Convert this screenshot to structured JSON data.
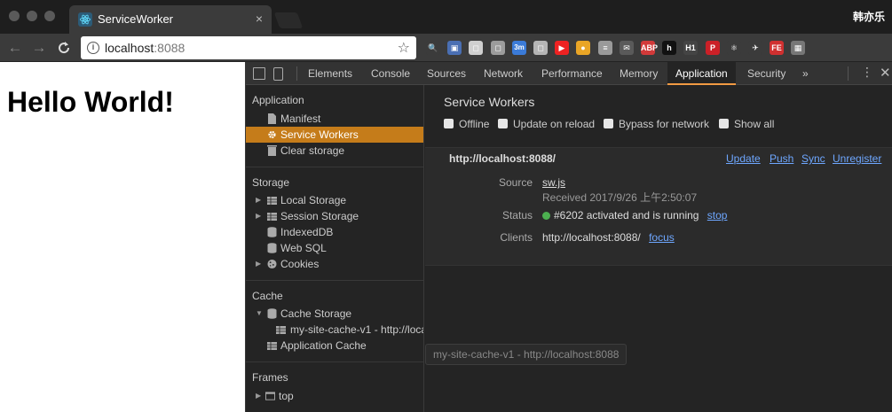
{
  "browser": {
    "tab_title": "ServiceWorker",
    "tab_close": "×",
    "username": "韩亦乐",
    "url_host": "localhost",
    "url_port": ":8088",
    "star": "☆",
    "back": "←",
    "forward": "→",
    "reload": "C",
    "extensions": [
      {
        "icon": "magnifier-icon",
        "label": "🔍",
        "color": "#3b3b3b"
      },
      {
        "icon": "picture-icon",
        "label": "▣",
        "color": "#4a6fb3"
      },
      {
        "icon": "box-icon",
        "label": "◻",
        "color": "#cfcfcf"
      },
      {
        "icon": "tile-icon",
        "label": "◻",
        "color": "#9c9c9c"
      },
      {
        "icon": "calendar-icon",
        "label": "3m",
        "color": "#3b7bd8"
      },
      {
        "icon": "page-icon",
        "label": "◻",
        "color": "#b5b5b5"
      },
      {
        "icon": "youtube-icon",
        "label": "▶",
        "color": "#e22"
      },
      {
        "icon": "chrome-icon",
        "label": "●",
        "color": "#e9a526"
      },
      {
        "icon": "note-icon",
        "label": "≡",
        "color": "#9a9a9a"
      },
      {
        "icon": "mail-icon",
        "label": "✉",
        "color": "#5a5a5a"
      },
      {
        "icon": "abp-icon",
        "label": "ABP",
        "color": "#d23a3a"
      },
      {
        "icon": "h-icon",
        "label": "h",
        "color": "#111"
      },
      {
        "icon": "h1-icon",
        "label": "H1",
        "color": "#444"
      },
      {
        "icon": "pinterest-icon",
        "label": "P",
        "color": "#cb2027"
      },
      {
        "icon": "react-icon",
        "label": "⚛",
        "color": "#3b3b3b"
      },
      {
        "icon": "bird-icon",
        "label": "✈",
        "color": "#3b3b3b"
      },
      {
        "icon": "fe-icon",
        "label": "FE",
        "color": "#d03030"
      },
      {
        "icon": "layout-icon",
        "label": "▦",
        "color": "#777"
      }
    ]
  },
  "page": {
    "heading": "Hello World!"
  },
  "devtools": {
    "tabs": [
      "Elements",
      "Console",
      "Sources",
      "Network",
      "Performance",
      "Memory",
      "Application",
      "Security",
      "»"
    ],
    "active_tab": "Application",
    "sidebar": {
      "application_head": "Application",
      "application_items": [
        "Manifest",
        "Service Workers",
        "Clear storage"
      ],
      "storage_head": "Storage",
      "storage_items": [
        "Local Storage",
        "Session Storage",
        "IndexedDB",
        "Web SQL",
        "Cookies"
      ],
      "cache_head": "Cache",
      "cache_items": [
        "Cache Storage",
        "my-site-cache-v1 - http://localhost:8088",
        "Application Cache"
      ],
      "frames_head": "Frames",
      "frames_items": [
        "top"
      ]
    },
    "main": {
      "title": "Service Workers",
      "checkboxes": [
        "Offline",
        "Update on reload",
        "Bypass for network",
        "Show all"
      ],
      "origin": "http://localhost:8088/",
      "actions": [
        "Update",
        "Push",
        "Sync",
        "Unregister"
      ],
      "source_label": "Source",
      "source_file": "sw.js",
      "received": "Received 2017/9/26 上午2:50:07",
      "status_label": "Status",
      "status_text": "#6202 activated and is running",
      "status_action": "stop",
      "clients_label": "Clients",
      "clients_value": "http://localhost:8088/",
      "clients_action": "focus"
    },
    "tooltip": "my-site-cache-v1 - http://localhost:8088"
  }
}
